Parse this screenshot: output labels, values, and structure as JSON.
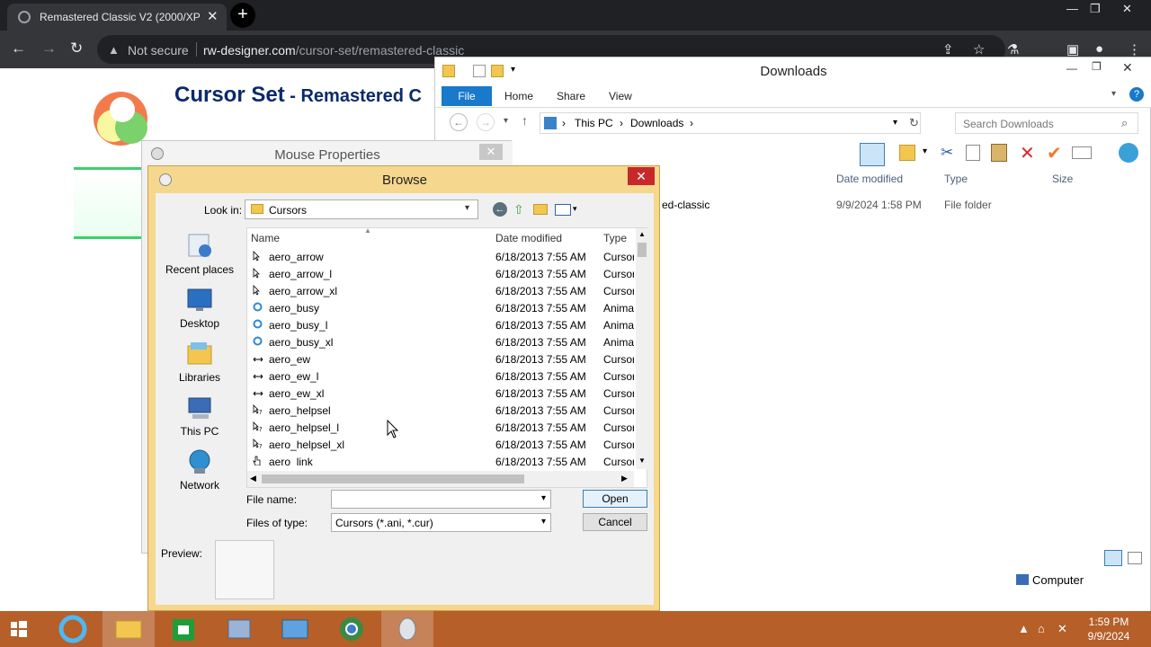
{
  "browser": {
    "tab_title": "Remastered Classic V2 (2000/XP",
    "tab_close": "✕",
    "new_tab": "+",
    "not_secure": "Not secure",
    "url_domain": "rw-designer.com",
    "url_path": "/cursor-set/remastered-classic"
  },
  "webpage": {
    "title_main": "Cursor Set",
    "title_sub": " - Remastered C"
  },
  "explorer": {
    "title": "Downloads",
    "ribbon": {
      "file": "File",
      "home": "Home",
      "share": "Share",
      "view": "View"
    },
    "address": {
      "this_pc": "This PC",
      "downloads": "Downloads"
    },
    "search_placeholder": "Search Downloads",
    "columns": {
      "date": "Date modified",
      "type": "Type",
      "size": "Size"
    },
    "row": {
      "name_fragment": "ed-classic",
      "date": "9/9/2024 1:58 PM",
      "type": "File folder"
    },
    "status_computer": "Computer"
  },
  "mouse_properties": {
    "title": "Mouse Properties",
    "close": "✕"
  },
  "browse": {
    "title": "Browse",
    "close": "✕",
    "look_in_label": "Look in:",
    "look_in_value": "Cursors",
    "places": [
      {
        "label": "Recent places",
        "icon": "recent-places-icon"
      },
      {
        "label": "Desktop",
        "icon": "desktop-icon"
      },
      {
        "label": "Libraries",
        "icon": "libraries-icon"
      },
      {
        "label": "This PC",
        "icon": "this-pc-icon"
      },
      {
        "label": "Network",
        "icon": "network-icon"
      }
    ],
    "columns": {
      "name": "Name",
      "date": "Date modified",
      "type": "Type"
    },
    "files": [
      {
        "name": "aero_arrow",
        "date": "6/18/2013 7:55 AM",
        "type": "Cursor",
        "icon": "arrow-cursor-icon"
      },
      {
        "name": "aero_arrow_l",
        "date": "6/18/2013 7:55 AM",
        "type": "Cursor",
        "icon": "arrow-cursor-icon"
      },
      {
        "name": "aero_arrow_xl",
        "date": "6/18/2013 7:55 AM",
        "type": "Cursor",
        "icon": "arrow-cursor-icon"
      },
      {
        "name": "aero_busy",
        "date": "6/18/2013 7:55 AM",
        "type": "Anima",
        "icon": "busy-ring-icon"
      },
      {
        "name": "aero_busy_l",
        "date": "6/18/2013 7:55 AM",
        "type": "Anima",
        "icon": "busy-ring-icon"
      },
      {
        "name": "aero_busy_xl",
        "date": "6/18/2013 7:55 AM",
        "type": "Anima",
        "icon": "busy-ring-icon"
      },
      {
        "name": "aero_ew",
        "date": "6/18/2013 7:55 AM",
        "type": "Cursor",
        "icon": "ew-resize-icon"
      },
      {
        "name": "aero_ew_l",
        "date": "6/18/2013 7:55 AM",
        "type": "Cursor",
        "icon": "ew-resize-icon"
      },
      {
        "name": "aero_ew_xl",
        "date": "6/18/2013 7:55 AM",
        "type": "Cursor",
        "icon": "ew-resize-icon"
      },
      {
        "name": "aero_helpsel",
        "date": "6/18/2013 7:55 AM",
        "type": "Cursor",
        "icon": "help-cursor-icon"
      },
      {
        "name": "aero_helpsel_l",
        "date": "6/18/2013 7:55 AM",
        "type": "Cursor",
        "icon": "help-cursor-icon"
      },
      {
        "name": "aero_helpsel_xl",
        "date": "6/18/2013 7:55 AM",
        "type": "Cursor",
        "icon": "help-cursor-icon"
      },
      {
        "name": "aero_link",
        "date": "6/18/2013 7:55 AM",
        "type": "Cursor",
        "icon": "hand-cursor-icon"
      }
    ],
    "file_name_label": "File name:",
    "file_name_value": "",
    "files_of_type_label": "Files of type:",
    "files_of_type_value": "Cursors (*.ani, *.cur)",
    "open_button": "Open",
    "cancel_button": "Cancel",
    "preview_label": "Preview:"
  },
  "taskbar": {
    "time": "1:59 PM",
    "date": "9/9/2024"
  },
  "colors": {
    "taskbar": "#b65f29",
    "browse_frame": "#f6d78e",
    "ribbon_file": "#1979ca",
    "close_red": "#c7282c"
  }
}
